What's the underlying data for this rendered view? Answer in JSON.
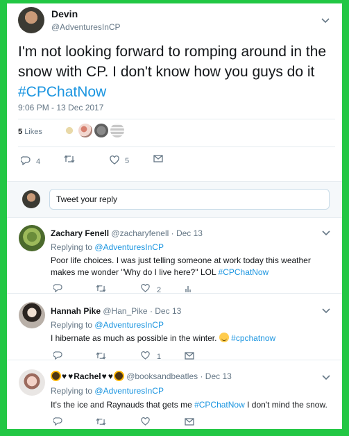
{
  "main_tweet": {
    "author_name": "Devin",
    "author_handle": "@AdventuresInCP",
    "text_plain": "I'm not looking forward to romping around in the snow with CP. I don't know how you guys do it ",
    "hashtag": "#CPChatNow",
    "timestamp": "9:06 PM - 13 Dec 2017",
    "likes_count": "5",
    "likes_label": "Likes",
    "reply_count": "4",
    "like_count": "5",
    "icons": [
      "reply-icon",
      "retweet-icon",
      "like-icon",
      "direct-message-icon",
      "chevron-down-icon"
    ]
  },
  "reply_box": {
    "placeholder": "Tweet your reply"
  },
  "replies": [
    {
      "name": "Zachary Fenell",
      "handle": "@zacharyfenell",
      "date": "· Dec 13",
      "replying_label": "Replying to",
      "replying_to": "@AdventuresInCP",
      "text": "Poor life choices. I was just telling someone at work today this weather makes me wonder \"Why do I live here?\" LOL ",
      "hashtag": "#CPChatNow",
      "like_count": "2"
    },
    {
      "name": "Hannah Pike",
      "handle": "@Han_Pike",
      "date": "· Dec 13",
      "replying_label": "Replying to",
      "replying_to": "@AdventuresInCP",
      "text": "I hibernate as much as possible in the winter. ",
      "hashtag": "#cpchatnow",
      "like_count": "1"
    },
    {
      "name": "Rachel",
      "handle": "@booksandbeatles",
      "date": "· Dec 13",
      "replying_label": "Replying to",
      "replying_to": "@AdventuresInCP",
      "text_pre": "It's the ice and Raynauds that gets me ",
      "hashtag": "#CPChatNow",
      "text_post": " I don't mind the snow."
    }
  ],
  "colors": {
    "background_border": "#22c744",
    "link_blue": "#1b95e0",
    "muted_gray": "#657786"
  }
}
